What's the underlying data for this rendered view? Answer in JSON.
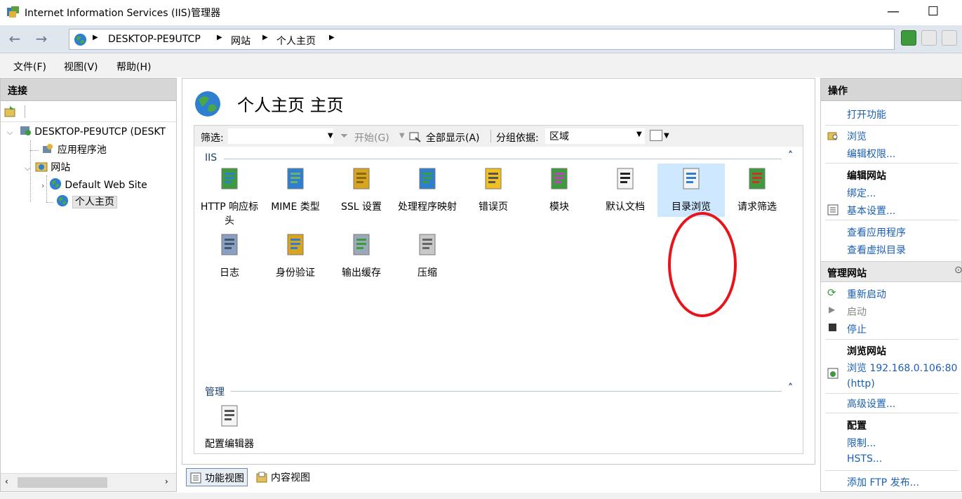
{
  "window": {
    "title": "Internet Information Services (IIS)管理器",
    "minimize": "—",
    "maximize": "☐"
  },
  "address": {
    "crumbs": [
      "DESKTOP-PE9UTCP",
      "网站",
      "个人主页"
    ]
  },
  "menu": [
    "文件(F)",
    "视图(V)",
    "帮助(H)"
  ],
  "connections": {
    "header": "连接",
    "tree": {
      "server": "DESKTOP-PE9UTCP (DESKT",
      "apppools": "应用程序池",
      "sites": "网站",
      "default_site": "Default Web Site",
      "personal_site": "个人主页"
    }
  },
  "main": {
    "title": "个人主页 主页",
    "filter_label": "筛选:",
    "start_label": "开始(G)",
    "showall_label": "全部显示(A)",
    "groupby_label": "分组依据:",
    "groupby_value": "区域",
    "sections": [
      {
        "name": "IIS",
        "features": [
          {
            "label": "HTTP 响应标头",
            "icon": "http-response-headers-icon"
          },
          {
            "label": "MIME 类型",
            "icon": "mime-types-icon"
          },
          {
            "label": "SSL 设置",
            "icon": "ssl-lock-icon"
          },
          {
            "label": "处理程序映射",
            "icon": "handler-mappings-icon"
          },
          {
            "label": "错误页",
            "icon": "error-pages-icon"
          },
          {
            "label": "模块",
            "icon": "modules-icon"
          },
          {
            "label": "默认文档",
            "icon": "default-document-icon"
          },
          {
            "label": "目录浏览",
            "icon": "directory-browsing-icon"
          },
          {
            "label": "请求筛选",
            "icon": "request-filtering-icon"
          },
          {
            "label": "日志",
            "icon": "logging-icon"
          },
          {
            "label": "身份验证",
            "icon": "authentication-icon"
          },
          {
            "label": "输出缓存",
            "icon": "output-caching-icon"
          },
          {
            "label": "压缩",
            "icon": "compression-icon"
          }
        ]
      },
      {
        "name": "管理",
        "features": [
          {
            "label": "配置编辑器",
            "icon": "configuration-editor-icon"
          }
        ]
      }
    ],
    "view_tabs": [
      "功能视图",
      "内容视图"
    ]
  },
  "actions": {
    "header": "操作",
    "open_feature": "打开功能",
    "explore": "浏览",
    "edit_permissions": "编辑权限...",
    "edit_site_header": "编辑网站",
    "bindings": "绑定...",
    "basic_settings": "基本设置...",
    "view_apps": "查看应用程序",
    "view_vdirs": "查看虚拟目录",
    "manage_site_header": "管理网站",
    "restart": "重新启动",
    "start": "启动",
    "stop": "停止",
    "browse_site_header": "浏览网站",
    "browse_link": "浏览 192.168.0.106:80 (http)",
    "advanced_settings": "高级设置...",
    "config_header": "配置",
    "limits": "限制...",
    "hsts": "HSTS...",
    "add_ftp": "添加 FTP 发布..."
  },
  "colors": {
    "link": "#1a5fb4",
    "selection": "#cde8ff",
    "annotation_circle": "#e8141a"
  }
}
